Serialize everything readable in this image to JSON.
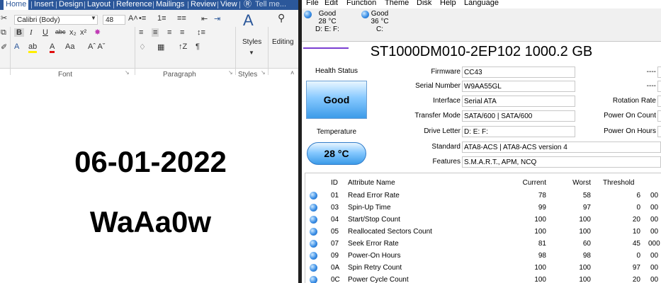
{
  "word": {
    "tabs": [
      "Home",
      "Insert",
      "Design",
      "Layout",
      "Reference",
      "Mailings",
      "Review",
      "View",
      "Tell me..."
    ],
    "font_name": "Calibri (Body)",
    "font_size": "48",
    "groups": {
      "font": "Font",
      "paragraph": "Paragraph",
      "styles": "Styles",
      "editing": "Editing"
    },
    "styles_label": "Styles",
    "editing_label": "Editing",
    "document_lines": [
      "06-01-2022",
      "WaAa0w"
    ]
  },
  "cdi": {
    "menu": [
      "File",
      "Edit",
      "Function",
      "Theme",
      "Disk",
      "Help",
      "Language"
    ],
    "drives": [
      {
        "status": "Good",
        "temp": "28 °C",
        "letters": "D: E: F:"
      },
      {
        "status": "Good",
        "temp": "36 °C",
        "letters": "C:"
      }
    ],
    "model": "ST1000DM010-2EP102 1000.2 GB",
    "health_label": "Health Status",
    "health_value": "Good",
    "temp_label": "Temperature",
    "temp_value": "28 °C",
    "fields": {
      "firmware_label": "Firmware",
      "firmware": "CC43",
      "serial_label": "Serial Number",
      "serial": "W9AA55GL",
      "interface_label": "Interface",
      "interface": "Serial ATA",
      "transfer_label": "Transfer Mode",
      "transfer": "SATA/600 | SATA/600",
      "drive_letter_label": "Drive Letter",
      "drive_letter": "D: E: F:",
      "standard_label": "Standard",
      "standard": "ATA8-ACS | ATA8-ACS version 4",
      "features_label": "Features",
      "features": "S.M.A.R.T., APM, NCQ",
      "right_blank1": "----",
      "right_blank2": "----",
      "rotation_label": "Rotation Rate",
      "power_on_count_label": "Power On Count",
      "power_on_hours_label": "Power On Hours"
    },
    "table": {
      "headers": {
        "id": "ID",
        "name": "Attribute Name",
        "current": "Current",
        "worst": "Worst",
        "threshold": "Threshold"
      },
      "rows": [
        {
          "id": "01",
          "name": "Read Error Rate",
          "current": "78",
          "worst": "58",
          "threshold": "6",
          "raw": "00"
        },
        {
          "id": "03",
          "name": "Spin-Up Time",
          "current": "99",
          "worst": "97",
          "threshold": "0",
          "raw": "00"
        },
        {
          "id": "04",
          "name": "Start/Stop Count",
          "current": "100",
          "worst": "100",
          "threshold": "20",
          "raw": "00"
        },
        {
          "id": "05",
          "name": "Reallocated Sectors Count",
          "current": "100",
          "worst": "100",
          "threshold": "10",
          "raw": "00"
        },
        {
          "id": "07",
          "name": "Seek Error Rate",
          "current": "81",
          "worst": "60",
          "threshold": "45",
          "raw": "000"
        },
        {
          "id": "09",
          "name": "Power-On Hours",
          "current": "98",
          "worst": "98",
          "threshold": "0",
          "raw": "00"
        },
        {
          "id": "0A",
          "name": "Spin Retry Count",
          "current": "100",
          "worst": "100",
          "threshold": "97",
          "raw": "00"
        },
        {
          "id": "0C",
          "name": "Power Cycle Count",
          "current": "100",
          "worst": "100",
          "threshold": "20",
          "raw": "00"
        }
      ]
    }
  }
}
